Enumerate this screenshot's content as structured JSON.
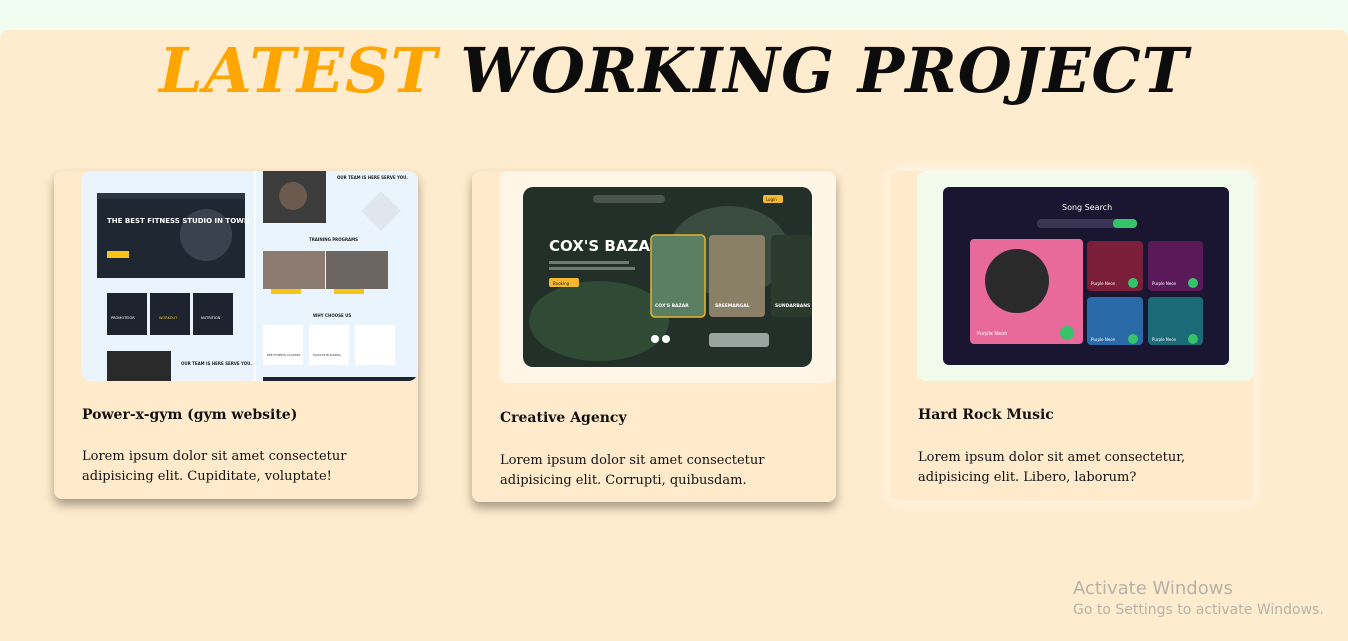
{
  "heading": {
    "accent": "LATEST",
    "rest": "WORKING PROJECT"
  },
  "colors": {
    "accent": "#ffa500",
    "section_bg": "#ffecce",
    "top_strip": "#f0fdf0"
  },
  "projects": [
    {
      "name": "Power-x-gym (gym website)",
      "description": "Lorem ipsum dolor sit amet consectetur adipisicing elit. Cupiditate, voluptate!",
      "preview": {
        "hero": "THE BEST FITNESS STUDIO IN TOWN",
        "team": "OUR TEAM IS HERE SERVE YOU.",
        "training": "TRAINING PROGRAMS",
        "programs": [
          "PROMOTEIOR",
          "WORKOUT",
          "NUTRITION"
        ],
        "choose": "WHY CHOOSE US",
        "classes": [
          "PEE FITNESS CLASSES",
          "MUSCLE BUILDING"
        ],
        "join": "OUR TEAM IS HERE SERVE YOU."
      }
    },
    {
      "name": "Creative Agency",
      "description": "Lorem ipsum dolor sit amet consectetur adipisicing elit. Corrupti, quibusdam.",
      "preview": {
        "hero": "COX'S BAZAR",
        "button": "Booking",
        "login": "Login",
        "places": [
          "COX'S BAZAR",
          "SREEMANGAL",
          "SUNDARBANS"
        ]
      }
    },
    {
      "name": "Hard Rock Music",
      "description": "Lorem ipsum dolor sit amet consectetur, adipisicing elit. Libero, laborum?",
      "preview": {
        "title": "Song Search",
        "featured": "Purple Neon",
        "tiles": [
          "Purple Neon",
          "Purple Neon",
          "Purple Neon",
          "Purple Neon"
        ]
      }
    }
  ],
  "watermark": {
    "line1": "Activate Windows",
    "line2": "Go to Settings to activate Windows."
  }
}
